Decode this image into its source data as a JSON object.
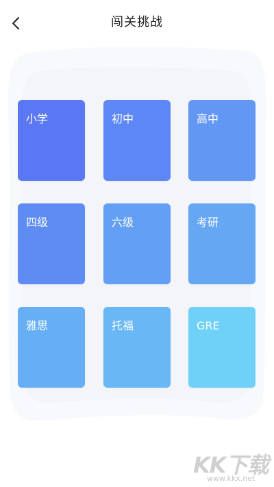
{
  "header": {
    "title": "闯关挑战",
    "back_icon": "chevron-left-icon"
  },
  "tiles": [
    {
      "label": "小学",
      "color": "#5B78F4"
    },
    {
      "label": "初中",
      "color": "#5D87F4"
    },
    {
      "label": "高中",
      "color": "#6297F4"
    },
    {
      "label": "四级",
      "color": "#5E8CF2"
    },
    {
      "label": "六级",
      "color": "#63A0F3"
    },
    {
      "label": "考研",
      "color": "#66A7F4"
    },
    {
      "label": "雅思",
      "color": "#66AFF4"
    },
    {
      "label": "托福",
      "color": "#69B7F5"
    },
    {
      "label": "GRE",
      "color": "#6FD0F8"
    }
  ],
  "watermark": {
    "logo_text": "KK下载",
    "url": "www.kkx.net"
  }
}
